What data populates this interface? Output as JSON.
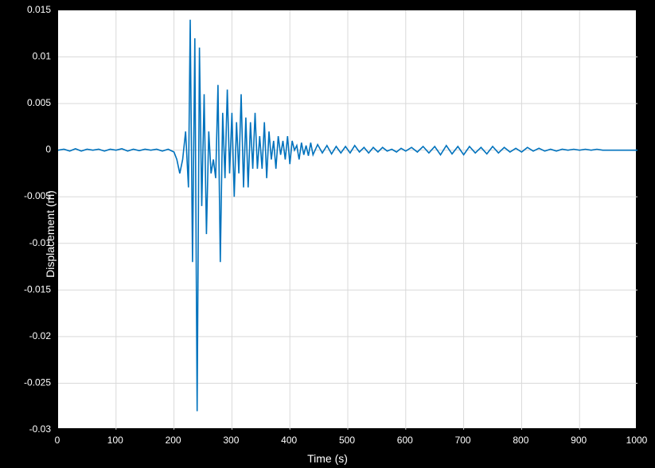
{
  "chart_data": {
    "type": "line",
    "title": "",
    "xlabel": "Time (s)",
    "ylabel": "Displacement (m)",
    "xlim": [
      0,
      1000
    ],
    "ylim": [
      -0.03,
      0.015
    ],
    "xticks": [
      0,
      100,
      200,
      300,
      400,
      500,
      600,
      700,
      800,
      900,
      1000
    ],
    "yticks": [
      -0.03,
      -0.025,
      -0.02,
      -0.015,
      -0.01,
      -0.005,
      0,
      0.005,
      0.01,
      0.015
    ],
    "grid": true,
    "series": [
      {
        "name": "displacement",
        "color": "#0072BD",
        "x": [
          0,
          10,
          20,
          30,
          40,
          50,
          60,
          70,
          80,
          90,
          100,
          110,
          120,
          130,
          140,
          150,
          160,
          170,
          180,
          190,
          200,
          205,
          210,
          215,
          220,
          225,
          228,
          232,
          236,
          240,
          244,
          248,
          252,
          256,
          260,
          264,
          268,
          272,
          276,
          280,
          284,
          288,
          292,
          296,
          300,
          304,
          308,
          312,
          316,
          320,
          324,
          328,
          332,
          336,
          340,
          344,
          348,
          352,
          356,
          360,
          364,
          368,
          372,
          376,
          380,
          384,
          388,
          392,
          396,
          400,
          404,
          408,
          412,
          416,
          420,
          424,
          428,
          432,
          436,
          440,
          448,
          456,
          464,
          472,
          480,
          488,
          496,
          504,
          512,
          520,
          528,
          536,
          544,
          552,
          560,
          568,
          576,
          584,
          592,
          600,
          610,
          620,
          630,
          640,
          650,
          660,
          670,
          680,
          690,
          700,
          710,
          720,
          730,
          740,
          750,
          760,
          770,
          780,
          790,
          800,
          810,
          820,
          830,
          840,
          850,
          860,
          870,
          880,
          890,
          900,
          910,
          920,
          930,
          940,
          950,
          960,
          970,
          980,
          990,
          1000
        ],
        "y": [
          0,
          0.0001,
          -0.0001,
          0.00015,
          -0.0001,
          0.0001,
          0,
          0.0001,
          -0.0001,
          0.0001,
          0,
          0.00015,
          -0.0001,
          0.0001,
          -5e-05,
          0.0001,
          0,
          0.0001,
          -0.0001,
          0.0001,
          -0.0002,
          -0.001,
          -0.0025,
          -0.001,
          0.002,
          -0.004,
          0.014,
          -0.012,
          0.012,
          -0.028,
          0.011,
          -0.006,
          0.006,
          -0.009,
          0.002,
          -0.0025,
          -0.001,
          -0.003,
          0.007,
          -0.012,
          0.004,
          -0.003,
          0.0065,
          -0.0025,
          0.004,
          -0.005,
          0.003,
          -0.0025,
          0.006,
          -0.004,
          0.0035,
          -0.004,
          0.003,
          -0.002,
          0.004,
          -0.002,
          0.0015,
          -0.002,
          0.003,
          -0.003,
          0.002,
          -0.001,
          0.001,
          -0.002,
          0.0015,
          -0.0005,
          0.001,
          -0.001,
          0.0015,
          -0.0015,
          0.001,
          0,
          0.0005,
          -0.001,
          0.0008,
          -0.0005,
          0.0005,
          -0.0006,
          0.0008,
          -0.0005,
          0.0006,
          -0.0003,
          0.0005,
          -0.0004,
          0.0004,
          -0.0003,
          0.0004,
          -0.0003,
          0.0005,
          -0.0002,
          0.0003,
          -0.0003,
          0.0003,
          -0.0002,
          0.0003,
          -0.0001,
          0.0001,
          -0.0002,
          0.0002,
          -0.0001,
          0.0003,
          -0.0002,
          0.0004,
          -0.0003,
          0.0004,
          -0.0005,
          0.0005,
          -0.0004,
          0.0004,
          -0.0005,
          0.0004,
          -0.0003,
          0.0003,
          -0.0004,
          0.0004,
          -0.0003,
          0.0003,
          -0.0002,
          0.0002,
          -0.0002,
          0.0003,
          -0.0001,
          0.0002,
          -0.0001,
          0.0001,
          -0.0001,
          0.0001,
          0,
          0.0001,
          0,
          0.0001,
          0,
          0.0001,
          0,
          0,
          0,
          0,
          0,
          0,
          0
        ]
      }
    ]
  }
}
